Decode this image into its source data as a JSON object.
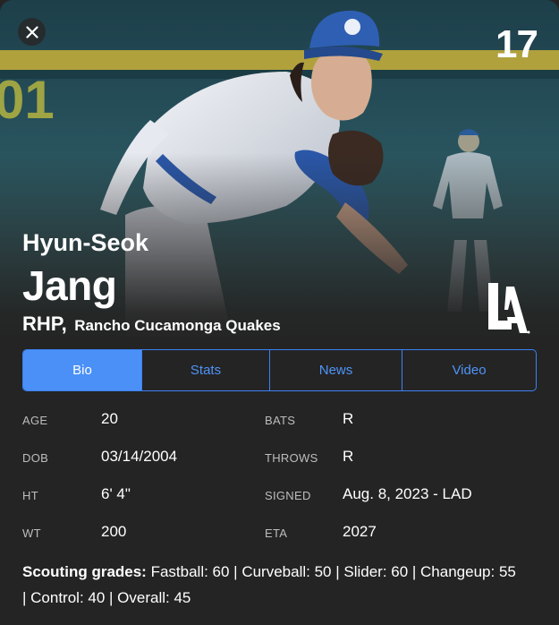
{
  "player": {
    "first_name": "Hyun-Seok",
    "last_name": "Jang",
    "position": "RHP",
    "comma": ",",
    "team": "Rancho Cucamonga Quakes",
    "jersey_number": "17",
    "team_logo": "LA"
  },
  "icons": {
    "close": "close-icon",
    "team_logo": "dodgers-la-logo"
  },
  "tabs": [
    {
      "label": "Bio",
      "active": true
    },
    {
      "label": "Stats",
      "active": false
    },
    {
      "label": "News",
      "active": false
    },
    {
      "label": "Video",
      "active": false
    }
  ],
  "bio": {
    "rows": [
      {
        "label1": "AGE",
        "value1": "20",
        "label2": "BATS",
        "value2": "R"
      },
      {
        "label1": "DOB",
        "value1": "03/14/2004",
        "label2": "THROWS",
        "value2": "R"
      },
      {
        "label1": "HT",
        "value1": "6' 4\"",
        "label2": "SIGNED",
        "value2": "Aug. 8, 2023 - LAD"
      },
      {
        "label1": "WT",
        "value1": "200",
        "label2": "ETA",
        "value2": "2027"
      }
    ]
  },
  "scouting": {
    "label": "Scouting grades:",
    "text": " Fastball: 60 | Curveball: 50 | Slider: 60 | Changeup: 55 | Control: 40 | Overall: 45"
  },
  "colors": {
    "background": "#242424",
    "accent": "#4a90f7",
    "tab_border": "#3b82f6",
    "cap_blue": "#2f5fb3"
  }
}
